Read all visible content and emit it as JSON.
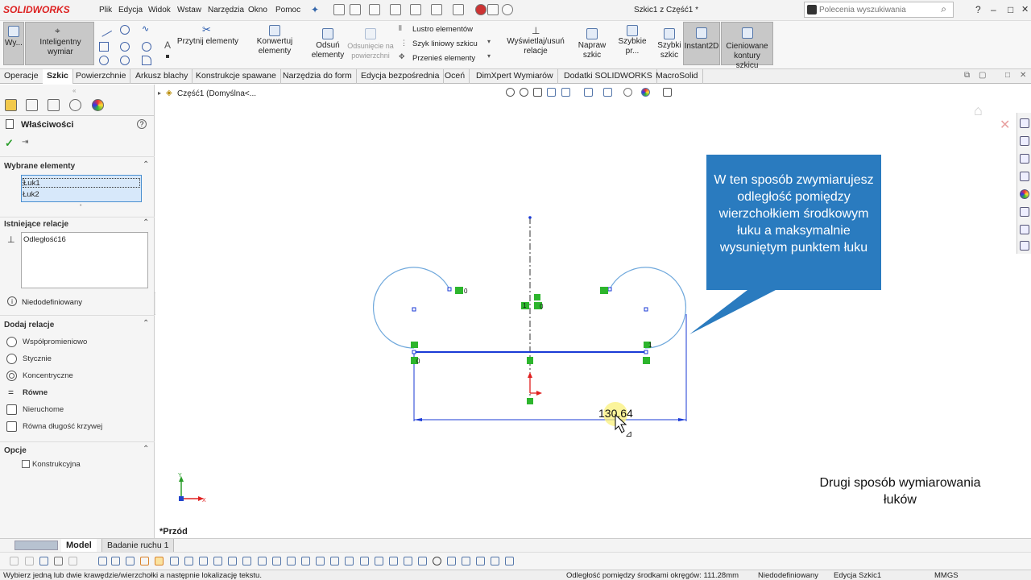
{
  "app": {
    "logo_text": "SOLIDWORKS",
    "document_title": "Szkic1 z Część1 *",
    "menu": [
      "Plik",
      "Edycja",
      "Widok",
      "Wstaw",
      "Narzędzia",
      "Okno",
      "Pomoc"
    ],
    "search_placeholder": "Polecenia wyszukiwania",
    "window_buttons": [
      "?",
      "–",
      "□",
      "✕"
    ]
  },
  "ribbon": {
    "tools": {
      "exit_sketch": "Wy...",
      "smart_dimension": "Inteligentny wymiar",
      "trim": "Przytnij elementy",
      "convert": "Konwertuj elementy",
      "offset": "Odsuń elementy",
      "offset_surface": "Odsunięcie na powierzchni",
      "mirror": "Lustro elementów",
      "linear_pattern": "Szyk liniowy szkicu",
      "move": "Przenieś elementy",
      "display_relations": "Wyświetlaj/usuń relacje",
      "repair": "Napraw szkic",
      "quick_snaps": "Szybkie pr...",
      "rapid_sketch": "Szybki szkic",
      "instant2d": "Instant2D",
      "shaded_contours": "Cieniowane kontury szkicu"
    }
  },
  "tabs": [
    "Operacje",
    "Szkic",
    "Powierzchnie",
    "Arkusz blachy",
    "Konstrukcje spawane",
    "Narzędzia do form",
    "Edycja bezpośrednia",
    "Oceń",
    "DimXpert Wymiarów",
    "Dodatki SOLIDWORKS",
    "MacroSolid"
  ],
  "active_tab": "Szkic",
  "property_manager": {
    "title": "Właściwości",
    "help": "?",
    "selected_header": "Wybrane elementy",
    "selected_items": [
      "Łuk1",
      "Łuk2"
    ],
    "existing_header": "Istniejące relacje",
    "existing_items": [
      "Odległość16"
    ],
    "status": "Niedodefiniowany",
    "add_header": "Dodaj relacje",
    "add_relations": [
      "Współpromieniowo",
      "Stycznie",
      "Koncentryczne",
      "Równe",
      "Nieruchome",
      "Równa długość krzywej"
    ],
    "options_header": "Opcje",
    "construction_label": "Konstrukcyjna"
  },
  "canvas": {
    "breadcrumb": "Część1  (Domyślna<...",
    "view_label": "*Przód",
    "dimension_value": "130.64",
    "callout": "W ten sposób zwymiarujesz odległość pomiędzy wierzchołkiem środkowym łuku a maksymalnie wysuniętym punktem łuku",
    "caption": "Drugi sposób wymiarowania łuków",
    "axis_x": "X",
    "axis_y": "Y",
    "relation_tags": [
      "0",
      "1",
      "0",
      "1",
      "0",
      "1",
      "1"
    ]
  },
  "model_tabs": [
    "Model",
    "Badanie ruchu 1"
  ],
  "status_bar": {
    "hint": "Wybierz jedną lub dwie krawędzie/wierzchołki a następnie lokalizację tekstu.",
    "distance": "Odległość pomiędzy środkami okręgów: 111.28mm",
    "state": "Niedodefiniowany",
    "mode": "Edycja Szkic1",
    "units": "MMGS"
  },
  "colors": {
    "accent_blue": "#2a7bbf",
    "sketch_blue": "#1a3ad6",
    "arc_blue": "#6fa8dc",
    "relation_green": "#2db52d",
    "highlight": "#d7e8fa",
    "logo_red": "#d22222"
  }
}
